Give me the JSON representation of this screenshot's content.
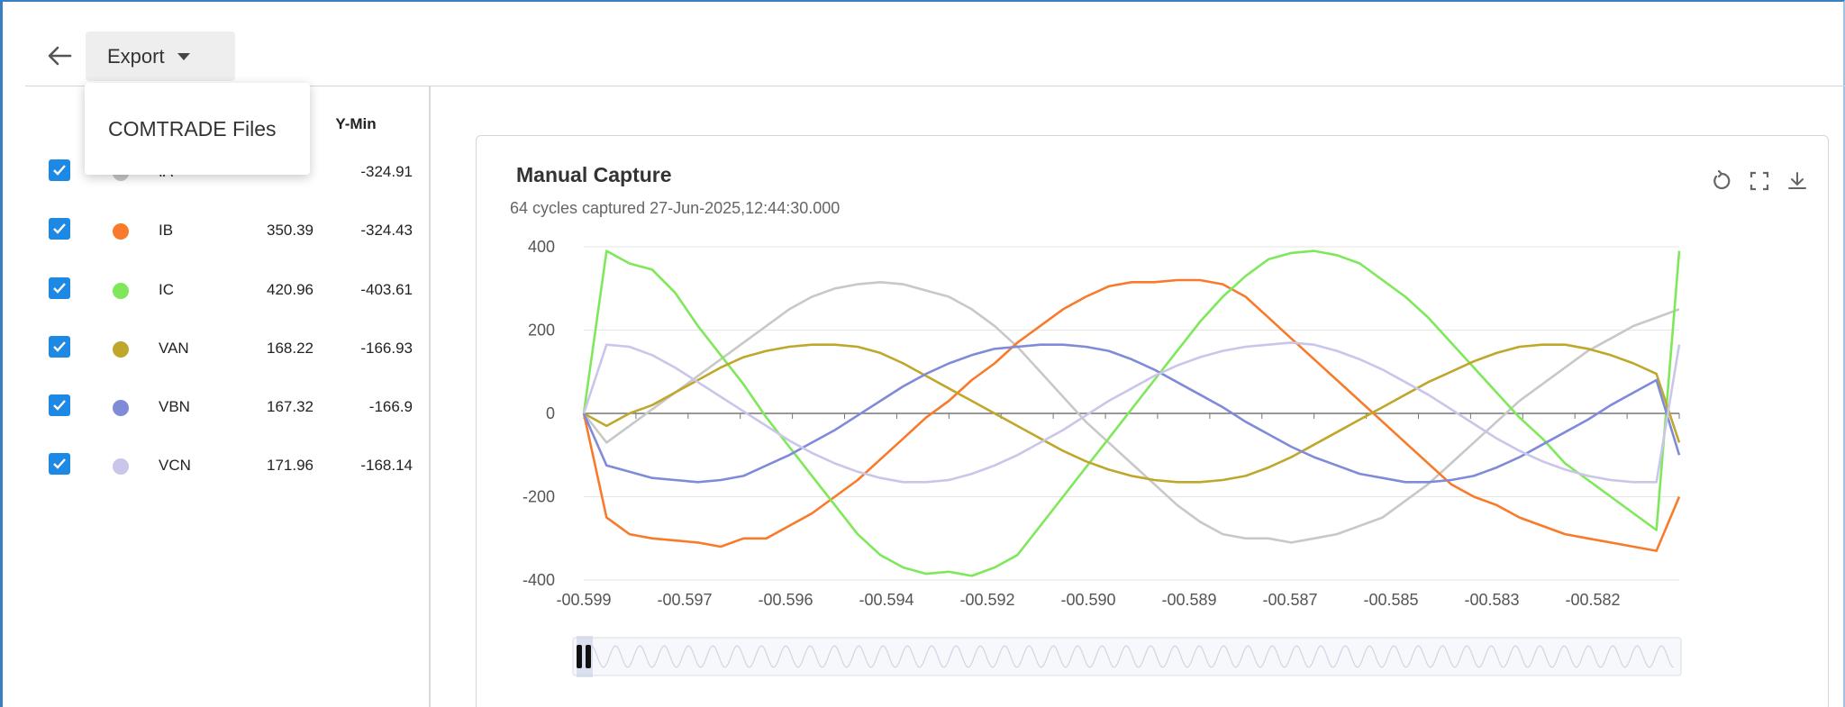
{
  "toolbar": {
    "export_label": "Export",
    "export_menu": [
      "COMTRADE Files"
    ]
  },
  "legend": {
    "headers": {
      "ymin": "Y-Min"
    },
    "rows": [
      {
        "name": "IA",
        "ymax": "",
        "ymin": "-324.91",
        "color": "#c8c8c8"
      },
      {
        "name": "IB",
        "ymax": "350.39",
        "ymin": "-324.43",
        "color": "#f97a2a"
      },
      {
        "name": "IC",
        "ymax": "420.96",
        "ymin": "-403.61",
        "color": "#7ee85a"
      },
      {
        "name": "VAN",
        "ymax": "168.22",
        "ymin": "-166.93",
        "color": "#bfa72c"
      },
      {
        "name": "VBN",
        "ymax": "167.32",
        "ymin": "-166.9",
        "color": "#7f8bd9"
      },
      {
        "name": "VCN",
        "ymax": "171.96",
        "ymin": "-168.14",
        "color": "#c9c6ea"
      }
    ]
  },
  "card": {
    "title": "Manual Capture",
    "subtitle": "64 cycles captured 27-Jun-2025,12:44:30.000",
    "icons": [
      "restore-icon",
      "fullscreen-icon",
      "download-icon"
    ]
  },
  "chart_data": {
    "type": "line",
    "xlabels": [
      "-00.599",
      "-00.597",
      "-00.596",
      "-00.594",
      "-00.592",
      "-00.590",
      "-00.589",
      "-00.587",
      "-00.585",
      "-00.583",
      "-00.582"
    ],
    "ylim": [
      -400,
      400
    ],
    "yticks": [
      400,
      200,
      0,
      -200,
      -400
    ],
    "grid": true,
    "legend": "left-panel",
    "num_points": 49,
    "series": [
      {
        "name": "IA",
        "color": "#c8c8c8",
        "values": [
          0,
          -70,
          -30,
          10,
          50,
          90,
          130,
          170,
          210,
          250,
          280,
          300,
          310,
          315,
          310,
          295,
          280,
          250,
          210,
          160,
          100,
          40,
          -20,
          -70,
          -120,
          -170,
          -220,
          -260,
          -290,
          -300,
          -300,
          -310,
          -300,
          -290,
          -270,
          -250,
          -210,
          -170,
          -120,
          -70,
          -20,
          30,
          70,
          110,
          150,
          180,
          210,
          230,
          250
        ]
      },
      {
        "name": "IB",
        "color": "#f97a2a",
        "values": [
          0,
          -250,
          -290,
          -300,
          -305,
          -310,
          -320,
          -300,
          -300,
          -270,
          -240,
          -200,
          -160,
          -110,
          -60,
          -10,
          30,
          80,
          120,
          170,
          210,
          250,
          280,
          305,
          315,
          315,
          320,
          320,
          310,
          280,
          230,
          180,
          130,
          80,
          30,
          -20,
          -70,
          -120,
          -170,
          -200,
          -220,
          -250,
          -270,
          -290,
          -300,
          -310,
          -320,
          -330,
          -200
        ]
      },
      {
        "name": "IC",
        "color": "#7ee85a",
        "values": [
          0,
          390,
          360,
          345,
          290,
          210,
          140,
          70,
          -10,
          -80,
          -150,
          -220,
          -290,
          -340,
          -370,
          -385,
          -380,
          -390,
          -370,
          -340,
          -270,
          -200,
          -130,
          -60,
          10,
          80,
          150,
          220,
          280,
          330,
          370,
          385,
          390,
          380,
          360,
          320,
          280,
          230,
          170,
          110,
          50,
          -10,
          -60,
          -120,
          -160,
          -200,
          -240,
          -280,
          390
        ]
      },
      {
        "name": "VAN",
        "color": "#bfa72c",
        "values": [
          0,
          -30,
          0,
          20,
          50,
          80,
          110,
          135,
          150,
          160,
          165,
          165,
          160,
          145,
          120,
          90,
          60,
          30,
          0,
          -30,
          -60,
          -90,
          -115,
          -135,
          -150,
          -160,
          -165,
          -165,
          -160,
          -150,
          -130,
          -105,
          -75,
          -45,
          -15,
          15,
          45,
          75,
          100,
          125,
          145,
          160,
          165,
          165,
          155,
          140,
          120,
          95,
          -70
        ]
      },
      {
        "name": "VBN",
        "color": "#7f8bd9",
        "values": [
          0,
          -125,
          -140,
          -155,
          -160,
          -165,
          -160,
          -150,
          -125,
          -100,
          -70,
          -40,
          -5,
          30,
          65,
          95,
          120,
          140,
          155,
          160,
          165,
          165,
          160,
          150,
          130,
          105,
          75,
          45,
          15,
          -20,
          -50,
          -80,
          -105,
          -125,
          -145,
          -155,
          -165,
          -165,
          -160,
          -150,
          -130,
          -105,
          -75,
          -45,
          -15,
          20,
          50,
          80,
          -100
        ]
      },
      {
        "name": "VCN",
        "color": "#c9c6ea",
        "values": [
          0,
          165,
          160,
          140,
          110,
          75,
          40,
          5,
          -30,
          -65,
          -95,
          -120,
          -140,
          -155,
          -165,
          -165,
          -160,
          -145,
          -125,
          -100,
          -70,
          -40,
          -5,
          30,
          60,
          90,
          115,
          135,
          150,
          160,
          165,
          170,
          165,
          150,
          130,
          105,
          75,
          45,
          10,
          -25,
          -60,
          -90,
          -115,
          -135,
          -150,
          -160,
          -165,
          -165,
          165
        ]
      }
    ]
  }
}
